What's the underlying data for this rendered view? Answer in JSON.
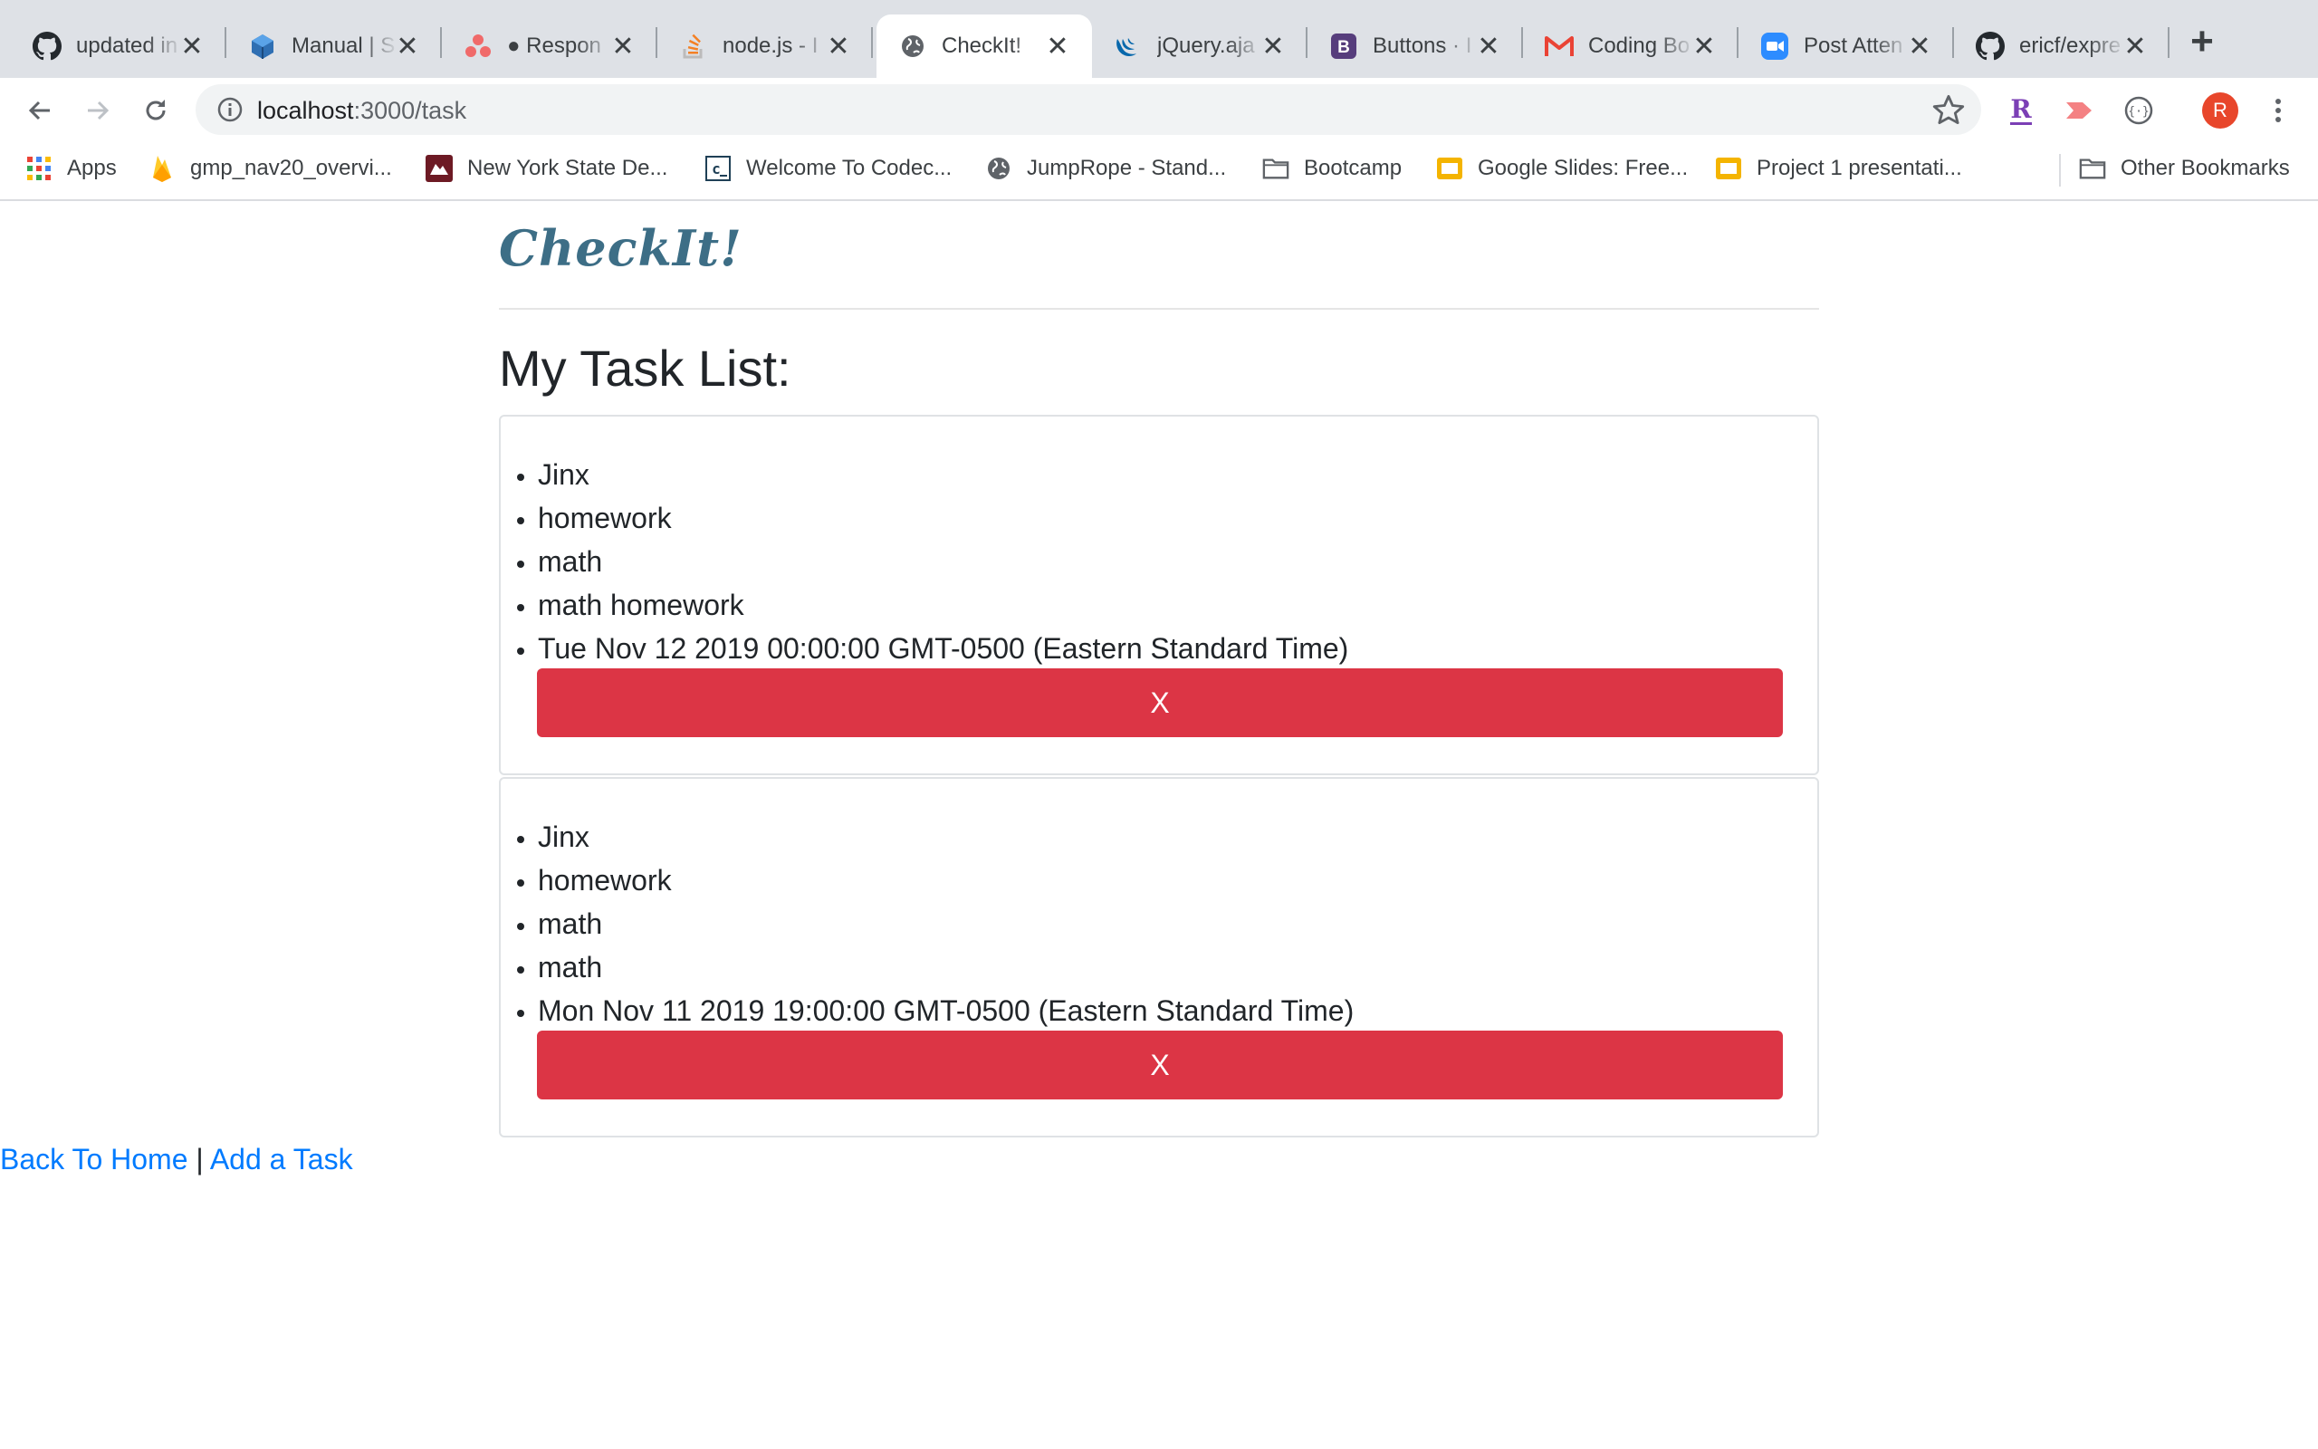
{
  "tabs": [
    {
      "title": "updated in",
      "icon": "github-icon"
    },
    {
      "title": "Manual | S",
      "icon": "cube-icon"
    },
    {
      "title": "● Respon",
      "icon": "asana-icon"
    },
    {
      "title": "node.js - I",
      "icon": "stackoverflow-icon"
    },
    {
      "title": "CheckIt!",
      "icon": "globe-icon",
      "active": true
    },
    {
      "title": "jQuery.aja",
      "icon": "jquery-icon"
    },
    {
      "title": "Buttons · I",
      "icon": "bootstrap-icon"
    },
    {
      "title": "Coding Bo",
      "icon": "gmail-icon"
    },
    {
      "title": "Post Atten",
      "icon": "zoom-icon"
    },
    {
      "title": "ericf/expre",
      "icon": "github-icon"
    }
  ],
  "address_bar": {
    "host": "localhost",
    "path": ":3000/task"
  },
  "bookmarks": [
    {
      "label": "Apps",
      "icon": "apps-grid-icon"
    },
    {
      "label": "gmp_nav20_overvi...",
      "icon": "firebase-icon"
    },
    {
      "label": "New York State De...",
      "icon": "nys-icon"
    },
    {
      "label": "Welcome To Codec...",
      "icon": "codecademy-icon"
    },
    {
      "label": "JumpRope - Stand...",
      "icon": "globe-icon"
    },
    {
      "label": "Bootcamp",
      "icon": "folder-icon"
    },
    {
      "label": "Google Slides: Free...",
      "icon": "slides-icon"
    },
    {
      "label": "Project 1 presentati...",
      "icon": "slides-icon"
    },
    {
      "label": "Other Bookmarks",
      "icon": "folder-icon"
    }
  ],
  "profile": {
    "initial": "R",
    "color": "#e8462b"
  },
  "page": {
    "brand": "CheckIt!",
    "heading": "My Task List:",
    "tasks": [
      {
        "items": [
          "Jinx",
          "homework",
          "math",
          "math homework",
          "Tue Nov 12 2019 00:00:00 GMT-0500 (Eastern Standard Time)"
        ],
        "delete_label": "X"
      },
      {
        "items": [
          "Jinx",
          "homework",
          "math",
          "math",
          "Mon Nov 11 2019 19:00:00 GMT-0500 (Eastern Standard Time)"
        ],
        "delete_label": "X"
      }
    ],
    "links": {
      "home": "Back To Home",
      "separator": " | ",
      "add": "Add a Task"
    }
  },
  "colors": {
    "accent_danger": "#dc3545",
    "link": "#007bff",
    "brand": "#3d6e86"
  }
}
